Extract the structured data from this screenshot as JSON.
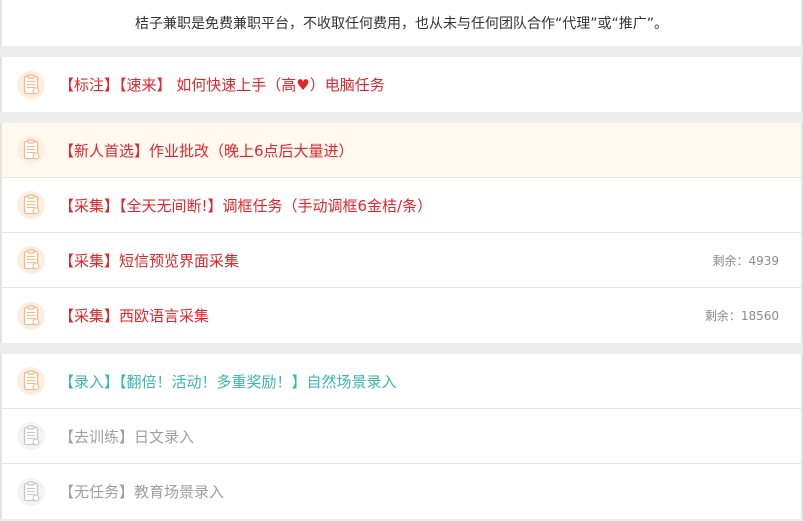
{
  "colors": {
    "red": "#e3262b",
    "teal": "#3cb6b0",
    "gray": "#a0a0a0",
    "icon_orange": "#f6b98a",
    "icon_gray": "#c8c8c8",
    "highlight_bg": "#fff9f0"
  },
  "notice": {
    "text": "桔子兼职是免费兼职平台，不收取任何费用，也从未与任何团队合作“代理”或“推广”。"
  },
  "groups": [
    {
      "tasks": [
        {
          "title": "【标注】【速来】 如何快速上手（高♥）电脑任务",
          "remaining": "",
          "color": "red",
          "icon": "clipboard-icon",
          "icon_color": "orange",
          "highlighted": false
        }
      ]
    },
    {
      "tasks": [
        {
          "title": "【新人首选】作业批改（晚上6点后大量进）",
          "remaining": "",
          "color": "red",
          "icon": "clipboard-icon",
          "icon_color": "orange",
          "highlighted": true
        },
        {
          "title": "【采集】【全天无间断!】调框任务（手动调框6金桔/条）",
          "remaining": "",
          "color": "red",
          "icon": "clipboard-icon",
          "icon_color": "orange",
          "highlighted": false
        },
        {
          "title": "【采集】短信预览界面采集",
          "remaining": "剩余：4939",
          "color": "red",
          "icon": "clipboard-icon",
          "icon_color": "orange",
          "highlighted": false
        },
        {
          "title": "【采集】西欧语言采集",
          "remaining": "剩余：18560",
          "color": "red",
          "icon": "clipboard-icon",
          "icon_color": "orange",
          "highlighted": false
        }
      ]
    },
    {
      "tasks": [
        {
          "title": "【录入】【翻倍！活动！多重奖励！】自然场景录入",
          "remaining": "",
          "color": "teal",
          "icon": "clipboard-icon",
          "icon_color": "orange",
          "highlighted": false
        },
        {
          "title": "【去训练】日文录入",
          "remaining": "",
          "color": "gray",
          "icon": "clipboard-icon",
          "icon_color": "gray",
          "highlighted": false
        },
        {
          "title": "【无任务】教育场景录入",
          "remaining": "",
          "color": "gray",
          "icon": "clipboard-icon",
          "icon_color": "gray",
          "highlighted": false
        }
      ]
    }
  ]
}
